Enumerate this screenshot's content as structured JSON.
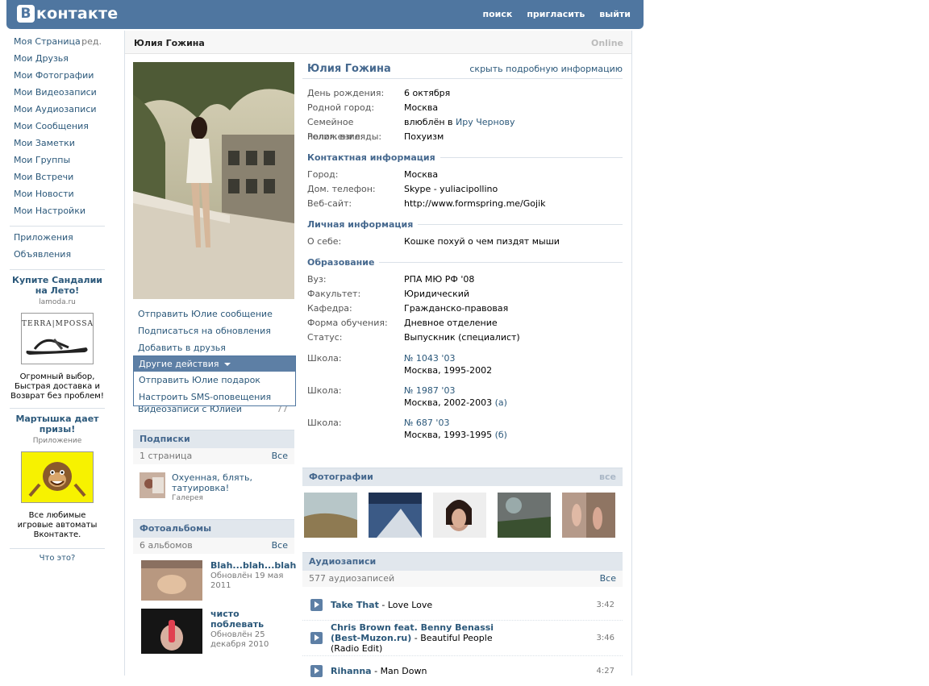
{
  "header": {
    "logo_letter": "B",
    "logo_text": "контакте",
    "nav": [
      "поиск",
      "пригласить",
      "выйти"
    ]
  },
  "leftnav": {
    "items": [
      {
        "label": "Моя Страница",
        "edit": "ред."
      },
      {
        "label": "Мои Друзья"
      },
      {
        "label": "Мои Фотографии"
      },
      {
        "label": "Мои Видеозаписи"
      },
      {
        "label": "Мои Аудиозаписи"
      },
      {
        "label": "Мои Сообщения"
      },
      {
        "label": "Мои Заметки"
      },
      {
        "label": "Мои Группы"
      },
      {
        "label": "Мои Встречи"
      },
      {
        "label": "Мои Новости"
      },
      {
        "label": "Мои Настройки"
      }
    ],
    "extra": [
      "Приложения",
      "Объявления"
    ],
    "ad1": {
      "title": "Купите Сандалии на Лето!",
      "domain": "lamoda.ru",
      "brand": "TERRA|MPOSSA",
      "desc": "Огромный выбор, Быстрая доставка и Возврат без проблем!"
    },
    "ad2": {
      "title": "Мартышка дает призы!",
      "domain": "Приложение",
      "desc": "Все любимые игровые автоматы Вконтакте."
    },
    "whatis": "Что это?"
  },
  "profile": {
    "title": "Юлия Гожина",
    "status": "Online",
    "name": "Юлия Гожина",
    "hide_link": "скрыть подробную информацию",
    "actions": [
      "Отправить Юлие сообщение",
      "Подписаться на обновления",
      "Добавить в друзья"
    ],
    "dropdown": {
      "head": "Другие действия",
      "items": [
        "Отправить Юлие подарок",
        "Настроить SMS-оповещения"
      ]
    },
    "under_dropdown": {
      "label": "Видеозаписи с Юлией",
      "count": "77"
    },
    "subs": {
      "title": "Подписки",
      "count": "1 страница",
      "all": "Все",
      "item_title": "Охуенная, блять, татуировка!",
      "item_sub": "Галерея"
    },
    "albums": {
      "title": "Фотоальбомы",
      "count": "6 альбомов",
      "all": "Все",
      "items": [
        {
          "name": "Blah...blah...blah",
          "updated": "Обновлён 19 мая 2011"
        },
        {
          "name": "чисто поблевать",
          "updated": "Обновлён 25 декабря 2010"
        }
      ]
    },
    "basic": [
      {
        "label": "День рождения:",
        "value": "6 октября",
        "link": true
      },
      {
        "label": "Родной город:",
        "value": "Москва",
        "link": true
      },
      {
        "label": "Семейное положение:",
        "value": "влюблён в ",
        "value_link": "Иру Чернову"
      },
      {
        "label": "Религ. взгляды:",
        "value": "Похуизм",
        "link": true
      }
    ],
    "contact": {
      "title": "Контактная информация",
      "rows": [
        {
          "label": "Город:",
          "value": "Москва",
          "link": true
        },
        {
          "label": "Дом. телефон:",
          "value": "Skype - yuliacipollino",
          "link": false
        },
        {
          "label": "Веб-сайт:",
          "value": "http://www.formspring.me/Gojik",
          "link": true
        }
      ]
    },
    "personal": {
      "title": "Личная информация",
      "rows": [
        {
          "label": "О себе:",
          "value": "Кошке похуй о чем пиздят мыши",
          "link": false
        }
      ]
    },
    "education": {
      "title": "Образование",
      "rows": [
        {
          "label": "Вуз:",
          "value": "РПА МЮ РФ '08",
          "link": true
        },
        {
          "label": "Факультет:",
          "value": "Юридический",
          "link": true
        },
        {
          "label": "Кафедра:",
          "value": "Гражданско-правовая",
          "link": true
        },
        {
          "label": "Форма обучения:",
          "value": "Дневное отделение",
          "link": true
        },
        {
          "label": "Статус:",
          "value": "Выпускник (специалист)",
          "link": true
        }
      ],
      "schools": [
        {
          "label": "Школа:",
          "name": "№ 1043 '03",
          "years": "Москва, 1995-2002",
          "class": ""
        },
        {
          "label": "Школа:",
          "name": "№ 1987 '03",
          "years": "Москва, 2002-2003",
          "class": "(а)"
        },
        {
          "label": "Школа:",
          "name": "№ 687 '03",
          "years": "Москва, 1993-1995",
          "class": "(б)"
        }
      ]
    },
    "photos": {
      "title": "Фотографии",
      "all": "все"
    },
    "audio": {
      "title": "Аудиозаписи",
      "count": "577 аудиозаписей",
      "all": "Все",
      "tracks": [
        {
          "artist": "Take That",
          "title": "Love Love",
          "duration": "3:42"
        },
        {
          "artist": "Chris Brown feat. Benny Benassi (Best-Muzon.ru)",
          "title": "Beautiful People (Radio Edit)",
          "duration": "3:46"
        },
        {
          "artist": "Rihanna",
          "title": "Man Down",
          "duration": "4:27"
        }
      ]
    }
  },
  "colors": {
    "header": "#4f76a0",
    "link": "#2b587a",
    "section": "#e1e7ed"
  }
}
